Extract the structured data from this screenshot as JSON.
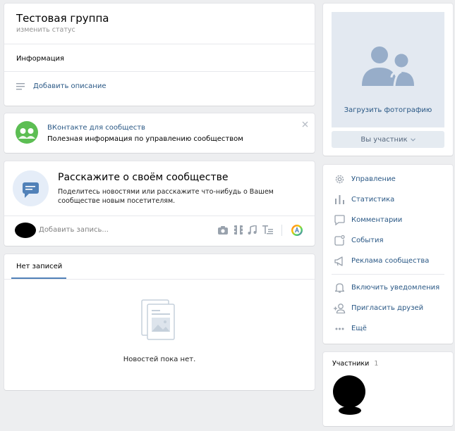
{
  "group": {
    "name": "Тестовая группа",
    "status_link": "изменить статус",
    "info_title": "Информация",
    "add_description": "Добавить описание"
  },
  "promo": {
    "title": "ВКонтакте для сообществ",
    "text": "Полезная информация по управлению сообществом"
  },
  "tell": {
    "title": "Расскажите о своём сообществе",
    "text_line1": "Поделитесь новостями или расскажите что-нибудь о Вашем",
    "text_line2": "сообществе новым посетителям.",
    "post_placeholder": "Добавить запись..."
  },
  "wall": {
    "tab": "Нет записей",
    "empty_text": "Новостей пока нет."
  },
  "sidebar": {
    "upload_photo": "Загрузить фотографию",
    "member_button": "Вы участник",
    "menu": [
      {
        "label": "Управление",
        "icon": "gear-icon"
      },
      {
        "label": "Статистика",
        "icon": "stats-icon"
      },
      {
        "label": "Комментарии",
        "icon": "comment-icon"
      },
      {
        "label": "События",
        "icon": "events-icon"
      },
      {
        "label": "Реклама сообщества",
        "icon": "megaphone-icon"
      }
    ],
    "menu2": [
      {
        "label": "Включить уведомления",
        "icon": "bell-icon"
      },
      {
        "label": "Пригласить друзей",
        "icon": "add-friend-icon"
      },
      {
        "label": "Ещё",
        "icon": "more-icon"
      }
    ],
    "members_label": "Участники",
    "members_count": "1"
  }
}
